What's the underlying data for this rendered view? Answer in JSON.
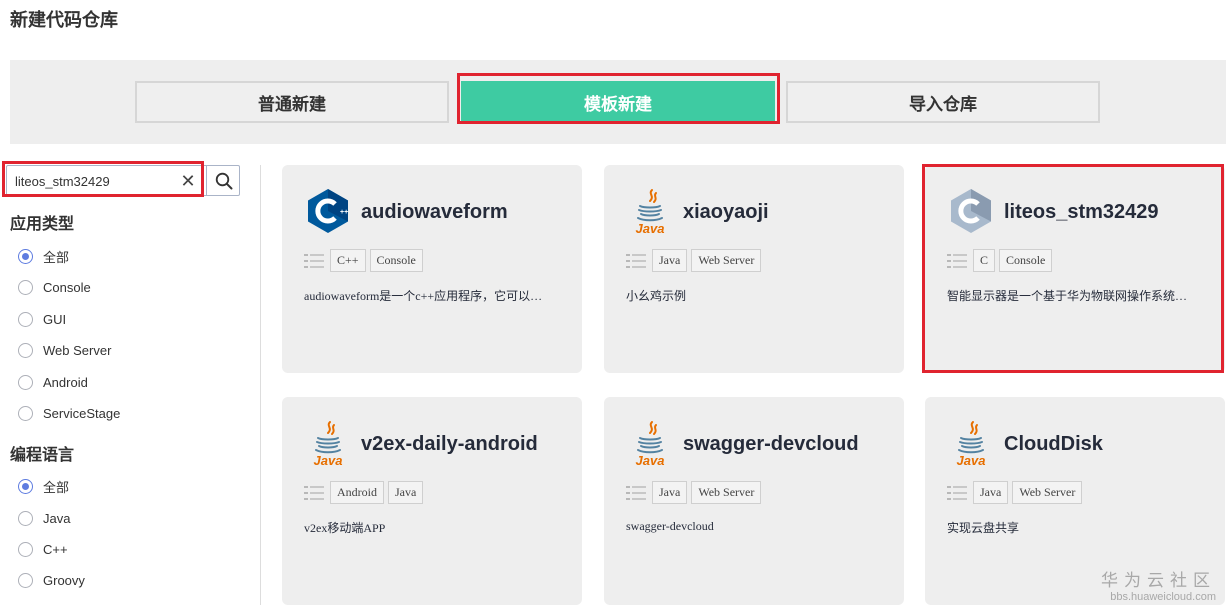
{
  "page": {
    "title": "新建代码仓库"
  },
  "modes": [
    {
      "label": "普通新建",
      "active": false
    },
    {
      "label": "模板新建",
      "active": true
    },
    {
      "label": "导入仓库",
      "active": false
    }
  ],
  "search": {
    "value": "liteos_stm32429",
    "clear_icon": "close-icon",
    "search_icon": "search-icon"
  },
  "filters": {
    "app_type": {
      "title": "应用类型",
      "options": [
        "全部",
        "Console",
        "GUI",
        "Web Server",
        "Android",
        "ServiceStage"
      ],
      "selected": "全部"
    },
    "language": {
      "title": "编程语言",
      "options": [
        "全部",
        "Java",
        "C++",
        "Groovy"
      ],
      "selected": "全部"
    }
  },
  "templates": [
    {
      "name": "audiowaveform",
      "logo": "cpp-icon",
      "tags": [
        "C++",
        "Console"
      ],
      "desc": "audiowaveform是一个c++应用程序，它可以…"
    },
    {
      "name": "xiaoyaoji",
      "logo": "java-icon",
      "tags": [
        "Java",
        "Web Server"
      ],
      "desc": "小幺鸡示例"
    },
    {
      "name": "liteos_stm32429",
      "logo": "c-icon",
      "tags": [
        "C",
        "Console"
      ],
      "desc": "智能显示器是一个基于华为物联网操作系统…"
    },
    {
      "name": "v2ex-daily-android",
      "logo": "java-icon",
      "tags": [
        "Android",
        "Java"
      ],
      "desc": "v2ex移动端APP"
    },
    {
      "name": "swagger-devcloud",
      "logo": "java-icon",
      "tags": [
        "Java",
        "Web Server"
      ],
      "desc": "swagger-devcloud"
    },
    {
      "name": "CloudDisk",
      "logo": "java-icon",
      "tags": [
        "Java",
        "Web Server"
      ],
      "desc": "实现云盘共享"
    }
  ],
  "watermark": {
    "main": "华为云社区",
    "sub": "bbs.huaweicloud.com"
  },
  "colors": {
    "accent": "#3ecba2",
    "highlight": "#e0232f",
    "radio": "#5e7ce0",
    "card_bg": "#eeeeee"
  }
}
